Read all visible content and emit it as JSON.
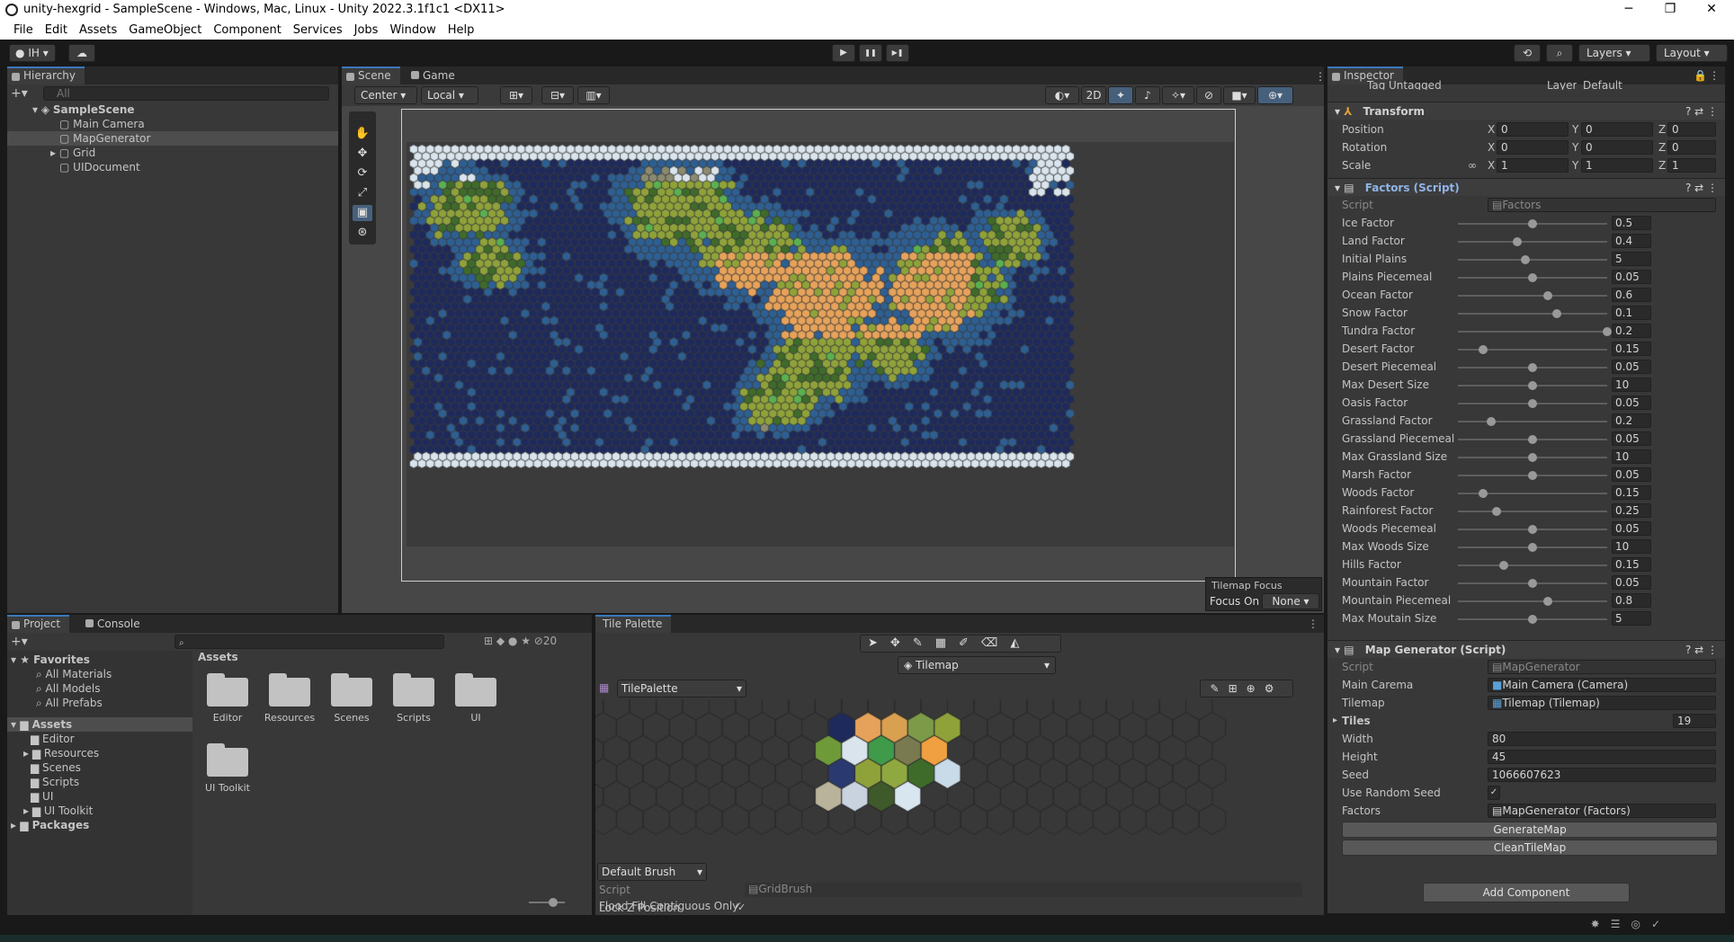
{
  "window": {
    "title": "unity-hexgrid - SampleScene - Windows, Mac, Linux - Unity 2022.3.1f1c1 <DX11>",
    "minimize": "─",
    "maximize": "❐",
    "close": "✕"
  },
  "menu": [
    "File",
    "Edit",
    "Assets",
    "GameObject",
    "Component",
    "Services",
    "Jobs",
    "Window",
    "Help"
  ],
  "toolbar": {
    "account": "IH",
    "layers": "Layers",
    "layout": "Layout",
    "play": "▶",
    "pause": "❚❚",
    "step": "▶❚"
  },
  "hierarchy": {
    "tab": "Hierarchy",
    "search_placeholder": "All",
    "scene": "SampleScene",
    "items": [
      "Main Camera",
      "MapGenerator",
      "Grid",
      "UIDocument"
    ]
  },
  "scene_view": {
    "tabs": [
      "Scene",
      "Game"
    ],
    "pivot": "Center",
    "space": "Local",
    "mode2d": "2D",
    "focus_title": "Tilemap Focus",
    "focus_on_label": "Focus On",
    "focus_value": "None"
  },
  "project": {
    "tabs": [
      "Project",
      "Console"
    ],
    "favorites": "Favorites",
    "fav_items": [
      "All Materials",
      "All Models",
      "All Prefabs"
    ],
    "assets": "Assets",
    "asset_items": [
      "Editor",
      "Resources",
      "Scenes",
      "Scripts",
      "UI",
      "UI Toolkit"
    ],
    "packages": "Packages",
    "breadcrumb": "Assets",
    "folders": [
      "Editor",
      "Resources",
      "Scenes",
      "Scripts",
      "UI",
      "UI Toolkit"
    ],
    "hidden_count": "20"
  },
  "tile_palette": {
    "tab": "Tile Palette",
    "target": "Tilemap",
    "palette": "TilePalette",
    "brush": "Default Brush",
    "script_label": "Script",
    "script_value": "GridBrush",
    "flood": "Flood Fill Contiguous Only",
    "lockz": "Lock Z Position"
  },
  "inspector": {
    "tab": "Inspector",
    "tag_label": "Tag",
    "tag": "Untagged",
    "layer_label": "Layer",
    "layer": "Default",
    "transform": {
      "title": "Transform",
      "position": "Position",
      "rotation": "Rotation",
      "scale": "Scale",
      "pos": [
        "0",
        "0",
        "0"
      ],
      "rot": [
        "0",
        "0",
        "0"
      ],
      "scl": [
        "1",
        "1",
        "1"
      ]
    },
    "factors": {
      "title": "Factors (Script)",
      "script_label": "Script",
      "script": "Factors",
      "rows": [
        {
          "label": "Ice Factor",
          "value": "0.5",
          "fraction": 0.5
        },
        {
          "label": "Land Factor",
          "value": "0.4",
          "fraction": 0.4
        },
        {
          "label": "Initial Plains",
          "value": "5",
          "fraction": 0.45
        },
        {
          "label": "Plains Piecemeal",
          "value": "0.05",
          "fraction": 0.5
        },
        {
          "label": "Ocean Factor",
          "value": "0.6",
          "fraction": 0.6
        },
        {
          "label": "Snow Factor",
          "value": "0.1",
          "fraction": 0.66
        },
        {
          "label": "Tundra Factor",
          "value": "0.2",
          "fraction": 1.0
        },
        {
          "label": "Desert Factor",
          "value": "0.15",
          "fraction": 0.17
        },
        {
          "label": "Desert Piecemeal",
          "value": "0.05",
          "fraction": 0.5
        },
        {
          "label": "Max Desert Size",
          "value": "10",
          "fraction": 0.5
        },
        {
          "label": "Oasis Factor",
          "value": "0.05",
          "fraction": 0.5
        },
        {
          "label": "Grassland Factor",
          "value": "0.2",
          "fraction": 0.22
        },
        {
          "label": "Grassland Piecemeal",
          "value": "0.05",
          "fraction": 0.5
        },
        {
          "label": "Max Grassland Size",
          "value": "10",
          "fraction": 0.5
        },
        {
          "label": "Marsh Factor",
          "value": "0.05",
          "fraction": 0.5
        },
        {
          "label": "Woods Factor",
          "value": "0.15",
          "fraction": 0.17
        },
        {
          "label": "Rainforest Factor",
          "value": "0.25",
          "fraction": 0.26
        },
        {
          "label": "Woods Piecemeal",
          "value": "0.05",
          "fraction": 0.5
        },
        {
          "label": "Max Woods Size",
          "value": "10",
          "fraction": 0.5
        },
        {
          "label": "Hills Factor",
          "value": "0.15",
          "fraction": 0.31
        },
        {
          "label": "Mountain Factor",
          "value": "0.05",
          "fraction": 0.5
        },
        {
          "label": "Mountain Piecemeal",
          "value": "0.8",
          "fraction": 0.6
        },
        {
          "label": "Max Moutain Size",
          "value": "5",
          "fraction": 0.5
        }
      ]
    },
    "mapgen": {
      "title": "Map Generator (Script)",
      "script_label": "Script",
      "script": "MapGenerator",
      "camera_label": "Main Carema",
      "camera": "Main Camera (Camera)",
      "tilemap_label": "Tilemap",
      "tilemap": "Tilemap (Tilemap)",
      "tiles_label": "Tiles",
      "tiles": "19",
      "width_label": "Width",
      "width": "80",
      "height_label": "Height",
      "height": "45",
      "seed_label": "Seed",
      "seed": "1066607623",
      "random_label": "Use Random Seed",
      "factors_label": "Factors",
      "factors": "MapGenerator (Factors)",
      "generate": "GenerateMap",
      "clean": "CleanTileMap"
    },
    "add_component": "Add Component"
  },
  "colors": {
    "ocean": "#1e2a5c",
    "shallow": "#2e5f92",
    "plains": "#8fa23a",
    "desert": "#e6a25a",
    "snow": "#d9e4ec",
    "woods": "#3f6b2a",
    "accent": "#3a79bb"
  }
}
